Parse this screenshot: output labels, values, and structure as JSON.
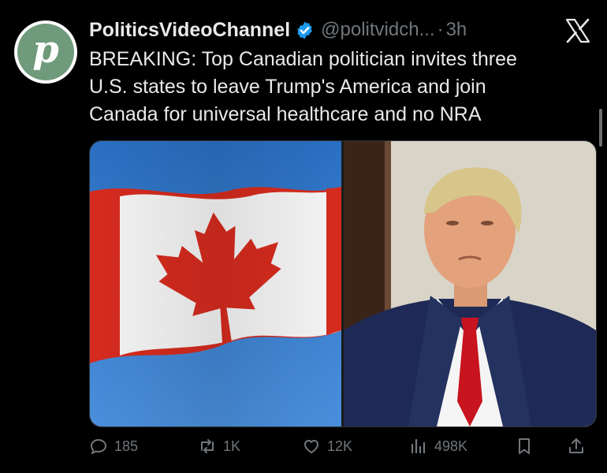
{
  "post": {
    "author_name": "PoliticsVideoChannel",
    "handle": "@politvidch...",
    "separator": "·",
    "time": "3h",
    "avatar_letter": "p",
    "text": "BREAKING: Top Canadian politician invites three\nU.S. states to leave Trump's America and join\nCanada for universal healthcare and no NRA"
  },
  "actions": {
    "replies": "185",
    "reposts": "1K",
    "likes": "12K",
    "views": "498K"
  },
  "colors": {
    "background": "#000000",
    "text_primary": "#e7e9ea",
    "text_secondary": "#71767b",
    "verified": "#1d9bf0",
    "avatar": "#6f9a7b",
    "flag_red": "#d52b1e",
    "sky": "#3b7fd0"
  },
  "icons": [
    "verified-badge-icon",
    "x-logo-icon",
    "reply-icon",
    "repost-icon",
    "like-icon",
    "views-icon",
    "bookmark-icon",
    "share-icon"
  ]
}
